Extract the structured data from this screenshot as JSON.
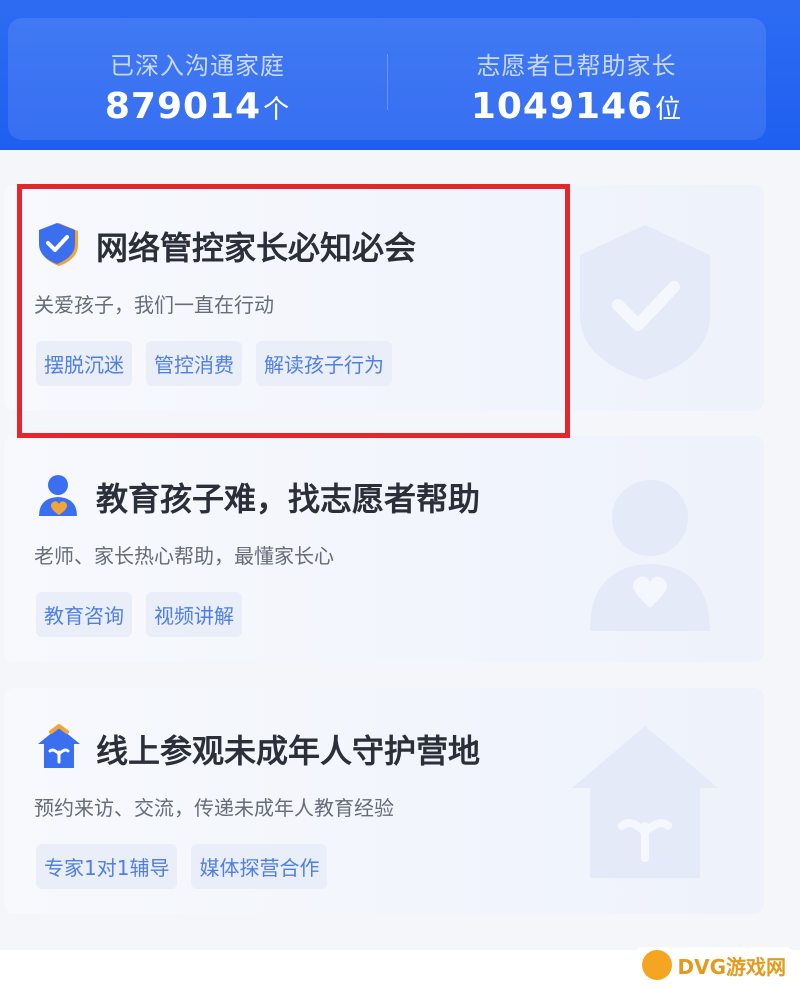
{
  "header": {
    "stats": [
      {
        "label": "已深入沟通家庭",
        "value": "879014",
        "unit": "个"
      },
      {
        "label": "志愿者已帮助家长",
        "value": "1049146",
        "unit": "位"
      }
    ]
  },
  "cards": [
    {
      "icon": "shield-check-icon",
      "title": "网络管控家长必知必会",
      "subtitle": "关爱孩子，我们一直在行动",
      "tags": [
        "摆脱沉迷",
        "管控消费",
        "解读孩子行为"
      ]
    },
    {
      "icon": "volunteer-heart-icon",
      "title": "教育孩子难，找志愿者帮助",
      "subtitle": "老师、家长热心帮助，最懂家长心",
      "tags": [
        "教育咨询",
        "视频讲解"
      ]
    },
    {
      "icon": "house-sprout-icon",
      "title": "线上参观未成年人守护营地",
      "subtitle": "预约来访、交流，传递未成年人教育经验",
      "tags": [
        "专家1对1辅导",
        "媒体探营合作"
      ]
    }
  ],
  "highlight": {
    "color": "#e5262c"
  },
  "theme": {
    "primary": "#1f5ff0",
    "tag_text": "#4f7fe6",
    "tag_bg": "#e9eef9"
  },
  "watermark": {
    "text": "DVG游戏网"
  }
}
